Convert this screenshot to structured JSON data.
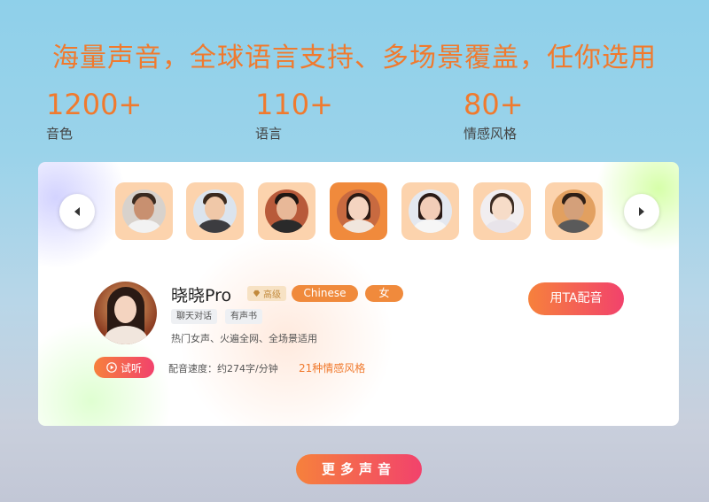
{
  "headline": "海量声音，全球语言支持、多场景覆盖，任你选用",
  "stats": [
    {
      "value": "1200+",
      "label": "音色"
    },
    {
      "value": "110+",
      "label": "语言"
    },
    {
      "value": "80+",
      "label": "情感风格"
    }
  ],
  "carousel": {
    "prev_icon": "chevron-left-icon",
    "next_icon": "chevron-right-icon",
    "active_index": 3,
    "avatars": [
      {
        "name": "male-voice-1"
      },
      {
        "name": "male-voice-2"
      },
      {
        "name": "male-voice-3"
      },
      {
        "name": "female-voice-xiaoxiao"
      },
      {
        "name": "female-voice-2"
      },
      {
        "name": "female-voice-3"
      },
      {
        "name": "male-voice-4"
      }
    ]
  },
  "voice": {
    "name": "晓晓Pro",
    "vip_label": "高级",
    "language_tag": "Chinese",
    "gender_tag": "女",
    "scene_tags": [
      "聊天对话",
      "有声书"
    ],
    "description": "热门女声、火遍全网、全场景适用",
    "try_label": "试听",
    "speed_text": "配音速度：约274字/分钟",
    "emotion_text": "21种情感风格",
    "use_label": "用TA配音"
  },
  "more_label": "更多声音",
  "colors": {
    "accent": "#f07a2e",
    "gradient_start": "#f6813c",
    "gradient_end": "#f2426c",
    "tile_bg": "#fcd3ad"
  }
}
